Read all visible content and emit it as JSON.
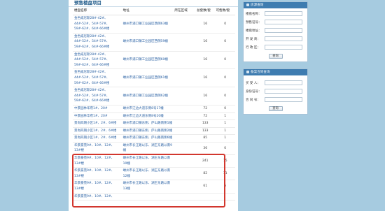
{
  "page": {
    "title": "预售楼盘项目",
    "columns": [
      "楼盘名称",
      "地址",
      "所在区域",
      "总套数/套",
      "可售数/套"
    ]
  },
  "rows": [
    {
      "name": "金色威尼斯28#-42#、44#-52#、54#-57#、59#-62#、64#-66#楼",
      "address": "嵊州市浦口镇工业园区西侧63幢",
      "area": "",
      "total": "16",
      "available": "0"
    },
    {
      "name": "金色威尼斯28#-42#、44#-52#、54#-57#、59#-62#、64#-66#楼",
      "address": "嵊州市浦口镇工业园区西侧59幢",
      "area": "",
      "total": "16",
      "available": "0"
    },
    {
      "name": "金色威尼斯28#-42#、44#-52#、54#-57#、59#-62#、64#-66#楼",
      "address": "嵊州市浦口镇工业园区西侧60幢",
      "area": "",
      "total": "16",
      "available": "0"
    },
    {
      "name": "金色威尼斯28#-42#、44#-52#、54#-57#、59#-62#、64#-66#楼",
      "address": "嵊州市浦口镇工业园区西侧61幢",
      "area": "",
      "total": "16",
      "available": "0"
    },
    {
      "name": "金色威尼斯28#-42#、44#-52#、54#-57#、59#-62#、64#-66#楼",
      "address": "嵊州市浦口镇工业园区西侧62幢",
      "area": "",
      "total": "16",
      "available": "0"
    },
    {
      "name": "中景园林华府1#、20#",
      "address": "嵊州市江边大道东侧8号17幢",
      "area": "",
      "total": "72",
      "available": "0"
    },
    {
      "name": "中景园林华府1#、20#",
      "address": "嵊州市江边大道东侧8号20幢",
      "area": "",
      "total": "72",
      "available": "1"
    },
    {
      "name": "景尚四期小区1#、2#、6#楼",
      "address": "嵊州市浦口镇东侧、庐山路南侧1幢",
      "area": "",
      "total": "133",
      "available": "1"
    },
    {
      "name": "景尚四期小区1#、2#、6#楼",
      "address": "嵊州市浦口镇东侧、庐山路南侧2幢",
      "area": "",
      "total": "133",
      "available": "1"
    },
    {
      "name": "景尚四期小区1#、2#、6#楼",
      "address": "嵊州市浦口镇东侧、庐山路南侧6幢",
      "area": "",
      "total": "85",
      "available": "1"
    },
    {
      "name": "华景豪苑9#、10#、12#、13#楼",
      "address": "嵊州市长江路以东、湖王东路以南9幢",
      "area": "",
      "total": "36",
      "available": "0"
    },
    {
      "name": "华景豪苑9#、10#、12#、13#楼",
      "address": "嵊州市长江路以东、湖王东路以南10幢",
      "area": "",
      "total": "241",
      "available": "15"
    },
    {
      "name": "华景豪苑9#、10#、12#、13#楼",
      "address": "嵊州市长江路以东、湖王东路以南12幢",
      "area": "",
      "total": "82",
      "available": "11"
    },
    {
      "name": "华景豪苑9#、10#、12#、13#楼",
      "address": "嵊州市长江路以东、湖王东路以南13幢",
      "area": "",
      "total": "61",
      "available": "6"
    },
    {
      "name": "华景豪苑9#、10#、12#、",
      "address": "",
      "area": "",
      "total": "",
      "available": ""
    }
  ],
  "sidebar": {
    "search_panel": {
      "title": "房源查询",
      "fields": [
        "楼盘名称：",
        "预售证号：",
        "楼盘地址：",
        "开 发 商：",
        "行 政 区："
      ],
      "button": "查询"
    },
    "contract_panel": {
      "title": "备案合同查询",
      "fields": [
        "买 受 人：",
        "身份证号：",
        "合 同 号："
      ],
      "button": "查询"
    }
  }
}
